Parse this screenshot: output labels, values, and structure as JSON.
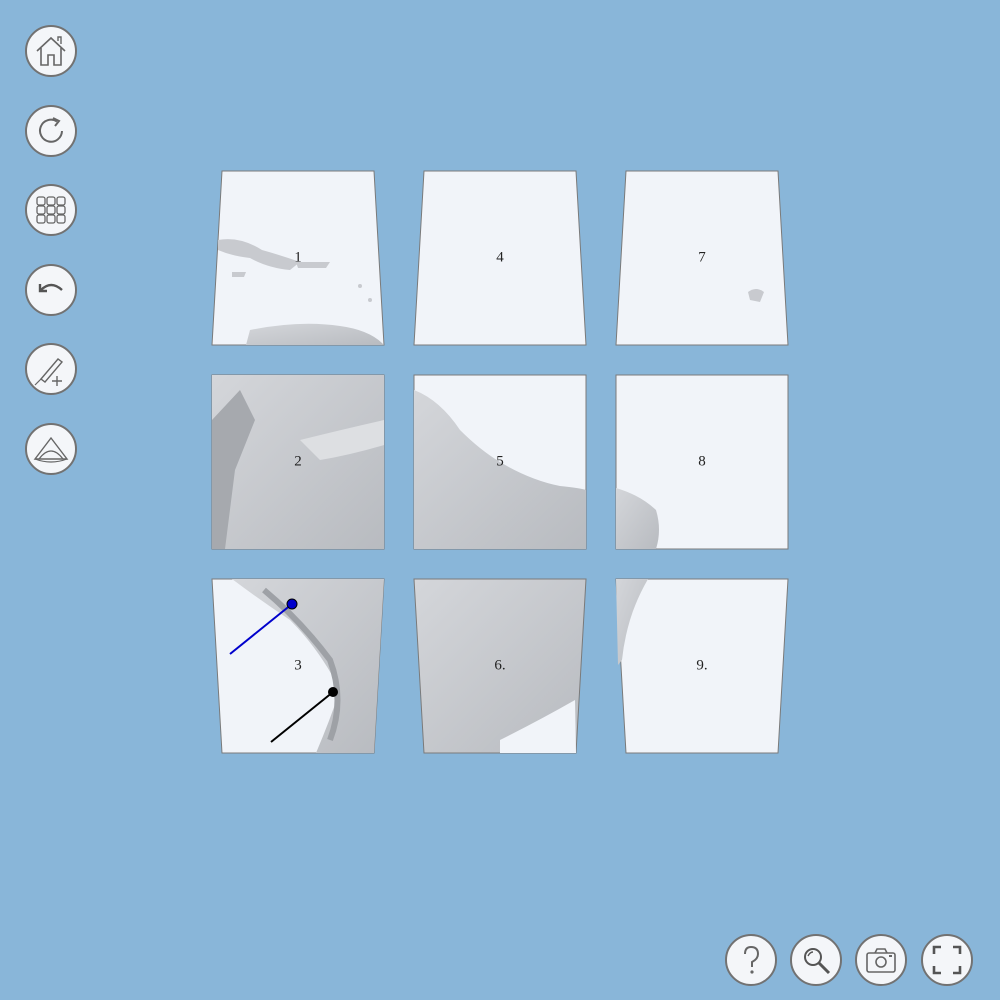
{
  "toolbar": {
    "buttons": [
      {
        "name": "home-button",
        "icon": "home-icon"
      },
      {
        "name": "reload-button",
        "icon": "reload-icon"
      },
      {
        "name": "tiles-button",
        "icon": "tiles-grid-icon"
      },
      {
        "name": "undo-button",
        "icon": "undo-icon"
      },
      {
        "name": "draw-add-button",
        "icon": "pencil-add-icon"
      },
      {
        "name": "projection-button",
        "icon": "globe-outline-icon"
      }
    ]
  },
  "bottom_bar": {
    "buttons": [
      {
        "name": "help-button",
        "icon": "help-icon"
      },
      {
        "name": "zoom-button",
        "icon": "magnifier-icon"
      },
      {
        "name": "screenshot-button",
        "icon": "camera-icon"
      },
      {
        "name": "fullscreen-button",
        "icon": "fullscreen-icon"
      }
    ]
  },
  "tiles": [
    {
      "label": "1",
      "content": "caribbean"
    },
    {
      "label": "2",
      "content": "andes-north"
    },
    {
      "label": "3",
      "content": "andes-south"
    },
    {
      "label": "4",
      "content": "ocean"
    },
    {
      "label": "5",
      "content": "guiana-coast"
    },
    {
      "label": "6.",
      "content": "brazil-plateau"
    },
    {
      "label": "7",
      "content": "ocean-islands"
    },
    {
      "label": "8",
      "content": "brazil-east-tip"
    },
    {
      "label": "9.",
      "content": "ocean-coast"
    }
  ],
  "colors": {
    "background": "#89b6d9",
    "tile_fill": "#f1f4f9",
    "tile_border": "#7a7a7a",
    "relief_gray": "#c9cbcf",
    "pin_blue": "#0000cc",
    "pin_black": "#000000"
  }
}
